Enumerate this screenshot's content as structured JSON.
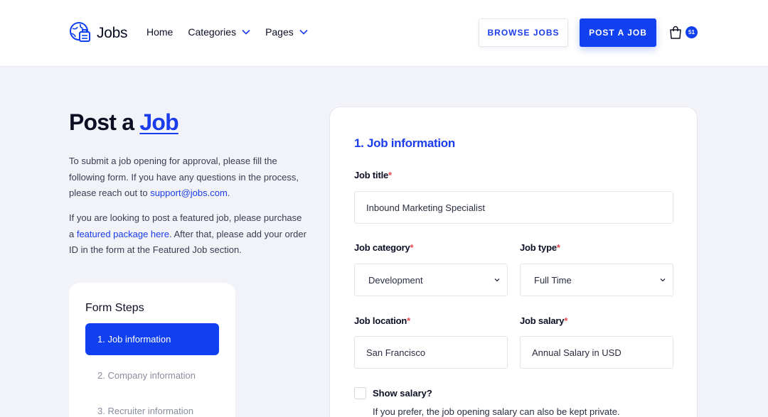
{
  "header": {
    "logo_text": "Jobs",
    "nav": [
      {
        "label": "Home",
        "has_dropdown": false
      },
      {
        "label": "Categories",
        "has_dropdown": true
      },
      {
        "label": "Pages",
        "has_dropdown": true
      }
    ],
    "browse_jobs_label": "BROWSE JOBS",
    "post_job_label": "POST A JOB",
    "cart_count": "51"
  },
  "intro": {
    "title_prefix": "Post a ",
    "title_accent": "Job",
    "para1_text": "To submit a job opening for approval, please fill the following form. If you have any questions in the process, please reach out to ",
    "para1_link": "support@jobs.com",
    "para1_end": ".",
    "para2_start": "If you are looking to post a featured job, please purchase a ",
    "para2_link": "featured package here",
    "para2_end": ". After that, please add your order ID in the form at the Featured Job section."
  },
  "steps": {
    "title": "Form Steps",
    "items": [
      {
        "label": "1. Job information",
        "active": true
      },
      {
        "label": "2. Company information",
        "active": false
      },
      {
        "label": "3. Recruiter information",
        "active": false
      }
    ]
  },
  "form": {
    "section_title": "1. Job information",
    "required_mark": "*",
    "job_title": {
      "label": "Job title",
      "value": "Inbound Marketing Specialist"
    },
    "job_category": {
      "label": "Job category",
      "value": "Development"
    },
    "job_type": {
      "label": "Job type",
      "value": "Full Time"
    },
    "job_location": {
      "label": "Job location",
      "value": "San Francisco"
    },
    "job_salary": {
      "label": "Job salary",
      "value": "Annual Salary in USD"
    },
    "show_salary": {
      "label": "Show salary?",
      "help": "If you prefer, the job opening salary can also be kept private.",
      "checked": false
    }
  },
  "colors": {
    "accent": "#1140f0",
    "required": "#e5484d",
    "background": "#f2f3f8"
  }
}
